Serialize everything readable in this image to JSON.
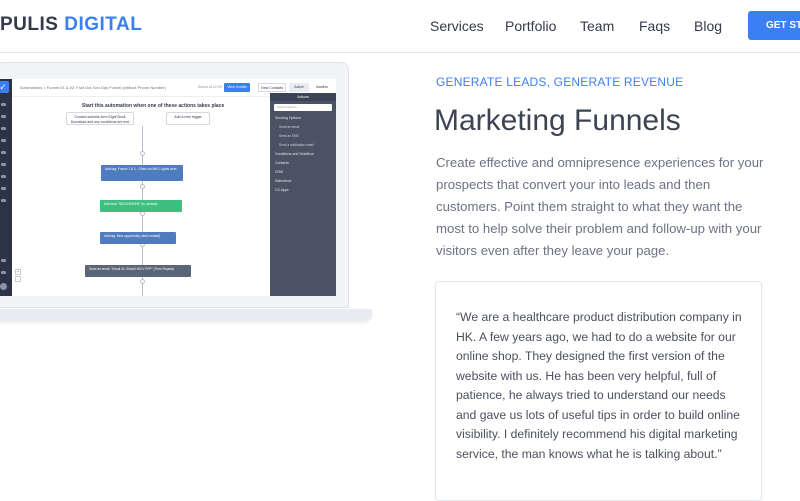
{
  "header": {
    "logo_part1": "PULIS ",
    "logo_part2": "DIGITAL",
    "nav": [
      "Services",
      "Portfolio",
      "Team",
      "Faqs",
      "Blog"
    ],
    "cta_label": "GET STA"
  },
  "mockup": {
    "breadcrumb": "Automations > Funnel #1 & #2: Fruit Dot Two Day Funnel (without Phone Number)",
    "saved_text": "Saved at 12:09",
    "view_credits_label": "View Credits",
    "view_contacts_label": "View Contacts",
    "active_label": "Active",
    "inactive_label": "Inactive",
    "panel_title": "Actions",
    "search_placeholder": "Search actions...",
    "panel_items": [
      "Sending Options",
      "Send an email",
      "Send an SMS",
      "Send a notification email",
      "Conditions and Workflow",
      "Contacts",
      "CRM",
      "Salesforce",
      "CX Apps"
    ],
    "canvas_title": "Start this automation when one of these actions takes place",
    "trigger_1": "Contact submits form Eight Book Download and any conditions are met",
    "trigger_2": "Add a new trigger",
    "actions": [
      "Add tag: Funnel 1 & 2 - Filled out MKG Lights form",
      "Add deal: \"MCLEARKER\" (to contact)",
      "Add tag: New opportunity (deal created)",
      "Send an email: \"Email #1: Email HDCV PPF\" (Then Repeat)"
    ],
    "zoom_in": "+",
    "zoom_out": "-"
  },
  "content": {
    "eyebrow": "GENERATE LEADS, GENERATE REVENUE",
    "title": "Marketing Funnels",
    "description": "Create effective and omnipresence experiences for your prospects that convert your into leads and then customers. Point them straight to what they want the most to help solve their problem and follow-up with your visitors even after they leave your page.",
    "testimonial": "“We are a healthcare product distribution company in HK. A few years ago, we had to do a website for our online shop. They designed the first version of the website with us. He has been very helpful, full of patience, he always tried to understand our needs and gave us lots of useful tips in order to build online visibility. I definitely recommend his digital marketing service, the man knows what he is talking about.”"
  },
  "colors": {
    "accent": "#3b7ff5",
    "heading": "#3d4351",
    "body_text": "#6b7283"
  }
}
